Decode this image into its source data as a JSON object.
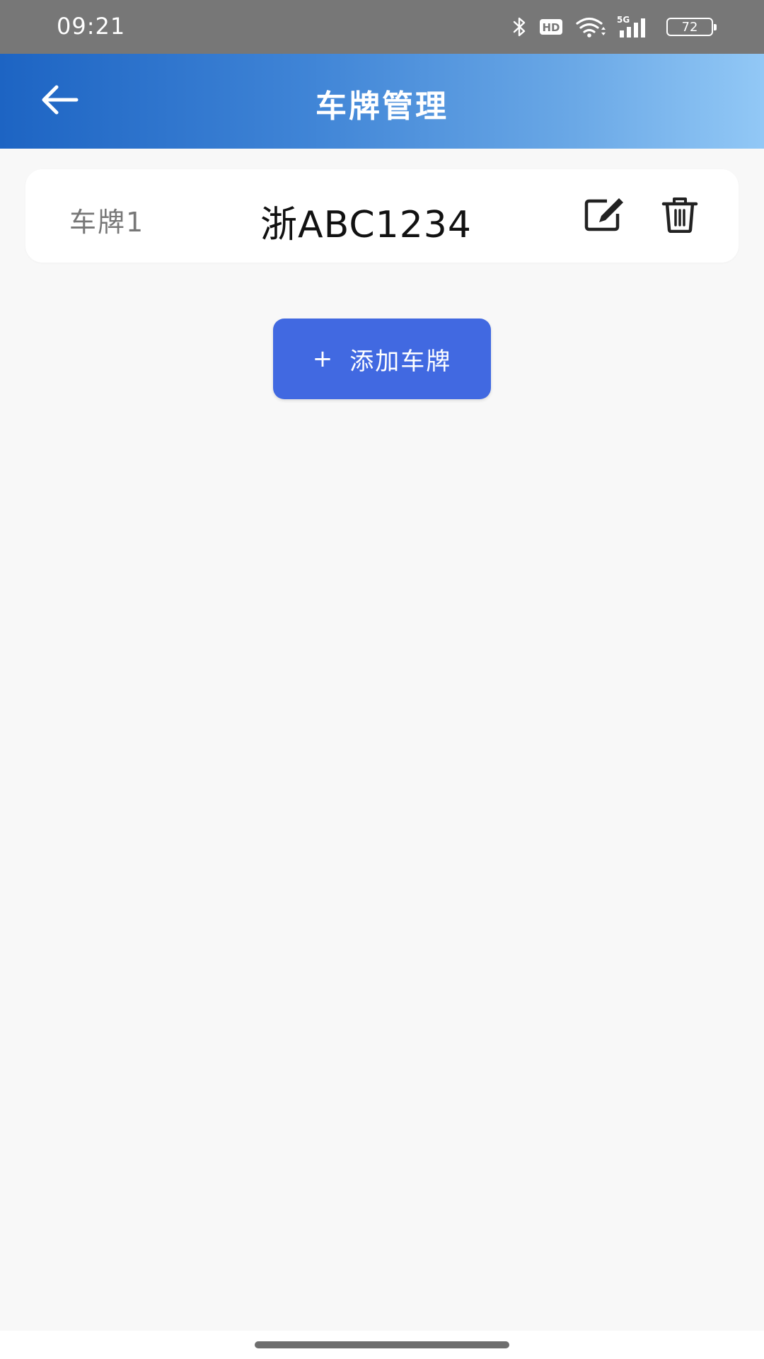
{
  "status_bar": {
    "time": "09:21",
    "hd_label": "HD",
    "network_label": "5G",
    "battery_level": "72",
    "icons": [
      "bluetooth-icon",
      "hd-icon",
      "wifi-icon",
      "signal-5g-icon",
      "battery-icon"
    ]
  },
  "header": {
    "title": "车牌管理",
    "back_icon": "arrow-left-icon"
  },
  "plates": [
    {
      "label": "车牌1",
      "number": "浙ABC1234",
      "edit_icon": "edit-icon",
      "delete_icon": "trash-icon"
    }
  ],
  "actions": {
    "add_plus": "+",
    "add_label": "添加车牌"
  },
  "colors": {
    "status_bar_bg": "#777777",
    "header_gradient_start": "#1d64c3",
    "header_gradient_end": "#92c8f6",
    "add_button_bg": "#4169e1",
    "page_bg": "#f8f8f8"
  }
}
